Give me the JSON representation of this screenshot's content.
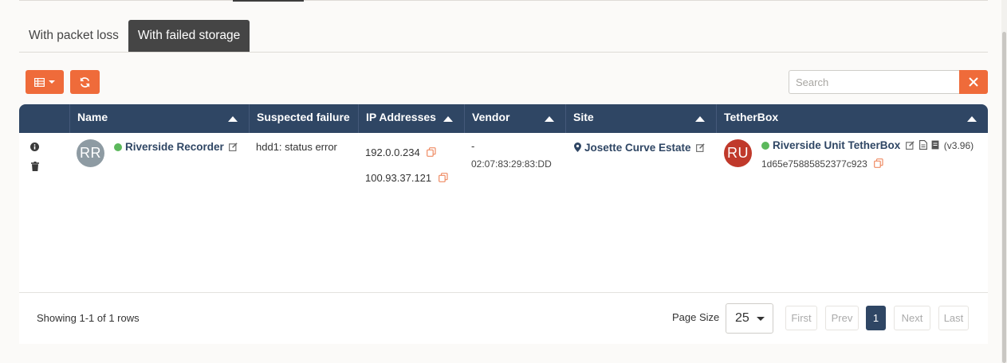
{
  "tabs": [
    {
      "label": "With packet loss"
    },
    {
      "label": "With failed storage"
    }
  ],
  "search": {
    "placeholder": "Search"
  },
  "table": {
    "columns": [
      {
        "label": ""
      },
      {
        "label": "Name"
      },
      {
        "label": "Suspected failure"
      },
      {
        "label": "IP Addresses"
      },
      {
        "label": "Vendor"
      },
      {
        "label": "Site"
      },
      {
        "label": "TetherBox"
      }
    ],
    "rows": [
      {
        "avatar_initials": "RR",
        "avatar_color": "#8e9ba3",
        "name": "Riverside Recorder",
        "status_color": "#5cb85c",
        "failure": "hdd1: status error",
        "ips": [
          "192.0.0.234",
          "100.93.37.121"
        ],
        "vendor": "-",
        "mac": "02:07:83:29:83:DD",
        "site": "Josette Curve Estate",
        "tetherbox_initials": "RU",
        "tetherbox_color": "#c0392b",
        "tetherbox_name": "Riverside Unit TetherBox",
        "tetherbox_version": "(v3.96)",
        "tetherbox_id": "1d65e75885852377c923"
      }
    ]
  },
  "footer": {
    "showing": "Showing 1-1 of 1 rows",
    "page_size_label": "Page Size",
    "page_size_value": "25",
    "pagination": {
      "first": "First",
      "prev": "Prev",
      "current": "1",
      "next": "Next",
      "last": "Last"
    }
  },
  "colors": {
    "accent": "#ef6b3a",
    "header": "#2f4664",
    "status_ok": "#5cb85c"
  }
}
